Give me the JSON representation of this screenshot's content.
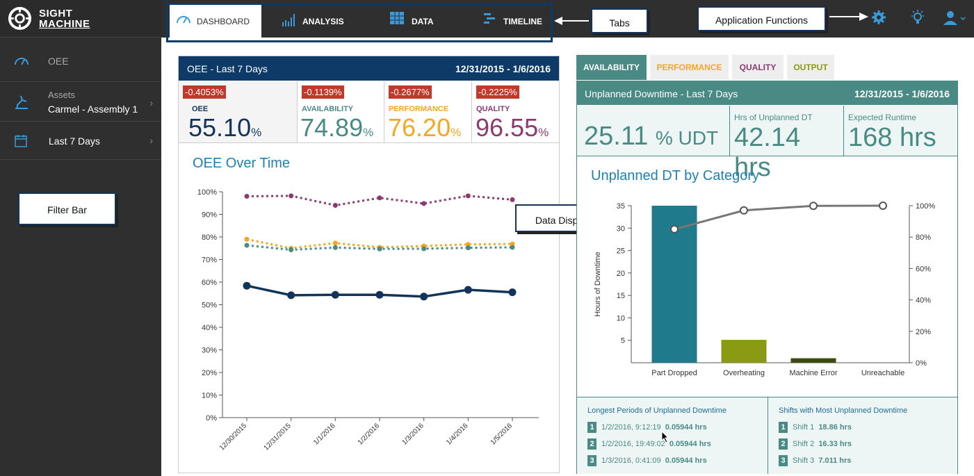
{
  "app": {
    "brand_line1": "SIGHT",
    "brand_line2": "MACHINE"
  },
  "tabs": [
    {
      "label": "DASHBOARD",
      "icon": "gauge-icon",
      "active": true
    },
    {
      "label": "ANALYSIS",
      "icon": "bar-chart-icon",
      "active": false
    },
    {
      "label": "DATA",
      "icon": "table-icon",
      "active": false
    },
    {
      "label": "TIMELINE",
      "icon": "timeline-icon",
      "active": false
    }
  ],
  "sidebar": {
    "oee_label": "OEE",
    "assets_label": "Assets",
    "assets_value": "Carmel - Assembly 1",
    "date_range": "Last 7 Days"
  },
  "callouts": {
    "tabs": "Tabs",
    "app_functions": "Application Functions",
    "filter_bar": "Filter Bar",
    "data_display": "Data Display"
  },
  "oee_panel": {
    "title": "OEE - Last 7 Days",
    "date_range": "12/31/2015 - 1/6/2016",
    "kpis": [
      {
        "name": "OEE",
        "delta": "-0.4053%",
        "value": "55.10",
        "unit": "%",
        "color": "#13345a"
      },
      {
        "name": "AVAILABILITY",
        "delta": "-0.1139%",
        "value": "74.89",
        "unit": "%",
        "color": "#4a8a85"
      },
      {
        "name": "PERFORMANCE",
        "delta": "-0.2677%",
        "value": "76.20",
        "unit": "%",
        "color": "#f5a623"
      },
      {
        "name": "QUALITY",
        "delta": "-0.2225%",
        "value": "96.55",
        "unit": "%",
        "color": "#8b3a6f"
      }
    ],
    "chart_title": "OEE Over Time"
  },
  "right_tabs": [
    {
      "label": "AVAILABILITY",
      "color": "#ffffff",
      "active": true
    },
    {
      "label": "PERFORMANCE",
      "color": "#f5a623",
      "active": false
    },
    {
      "label": "QUALITY",
      "color": "#8b3a6f",
      "active": false
    },
    {
      "label": "OUTPUT",
      "color": "#8a9a12",
      "active": false
    }
  ],
  "downtime_panel": {
    "title": "Unplanned Downtime - Last 7 Days",
    "date_range": "12/31/2015 - 1/6/2016",
    "udt_value": "25.11",
    "udt_unit": "% UDT",
    "hrs_label": "Hrs of Unplanned DT",
    "hrs_value": "42.14 hrs",
    "runtime_label": "Expected Runtime",
    "runtime_value": "168 hrs",
    "chart_title": "Unplanned DT by Category",
    "longest_title": "Longest Periods of Unplanned Downtime",
    "longest": [
      {
        "rank": "1",
        "when": "1/2/2016, 9:12:19",
        "hrs": "0.05944 hrs"
      },
      {
        "rank": "2",
        "when": "1/2/2016, 19:49:02",
        "hrs": "0.05944 hrs"
      },
      {
        "rank": "3",
        "when": "1/3/2016, 0:41:09",
        "hrs": "0.05944 hrs"
      }
    ],
    "shifts_title": "Shifts with Most Unplanned Downtime",
    "shifts": [
      {
        "rank": "1",
        "name": "Shift 1",
        "hrs": "18.86 hrs"
      },
      {
        "rank": "2",
        "name": "Shift 2",
        "hrs": "16.33 hrs"
      },
      {
        "rank": "3",
        "name": "Shift 3",
        "hrs": "7.011 hrs"
      }
    ]
  },
  "chart_data": [
    {
      "type": "line",
      "x": [
        "12/30/2015",
        "12/31/2015",
        "1/1/2016",
        "1/2/2016",
        "1/3/2016",
        "1/4/2016",
        "1/5/2016"
      ],
      "ylim": [
        0,
        100
      ],
      "yticks": [
        "0%",
        "10%",
        "20%",
        "30%",
        "40%",
        "50%",
        "60%",
        "70%",
        "80%",
        "90%",
        "100%"
      ],
      "series": [
        {
          "values": [
            98,
            98.2,
            94,
            97.3,
            94.8,
            98.2,
            96.5
          ],
          "color": "#8b3a6f",
          "dash": true
        },
        {
          "values": [
            79,
            75,
            77.3,
            75.4,
            76,
            76.7,
            76.9
          ],
          "color": "#f5a623",
          "dash": true
        },
        {
          "values": [
            76.3,
            74.3,
            75.3,
            74.7,
            74.8,
            75.2,
            75.4
          ],
          "color": "#4a8a85",
          "dash": true
        },
        {
          "values": [
            58.4,
            54.2,
            54.4,
            54.4,
            53.6,
            56.6,
            55.5
          ],
          "color": "#13345a",
          "dash": false
        }
      ]
    },
    {
      "type": "bar",
      "categories": [
        "Part Dropped",
        "Overheating",
        "Machine Error",
        "Unreachable"
      ],
      "values": [
        35.8,
        5.1,
        1.0,
        0
      ],
      "cumulative_pct": [
        85,
        97,
        99.9,
        100
      ],
      "ylabel": "Hours of Downtime",
      "ylim": [
        0,
        35
      ],
      "yticks": [
        "5",
        "10",
        "15",
        "20",
        "25",
        "30",
        "35"
      ],
      "y2ticks": [
        "0%",
        "20%",
        "40%",
        "60%",
        "80%",
        "100%"
      ],
      "bar_colors": [
        "#1f7a8c",
        "#8a9a12",
        "#3d4a12",
        "#1f7a8c"
      ]
    }
  ]
}
